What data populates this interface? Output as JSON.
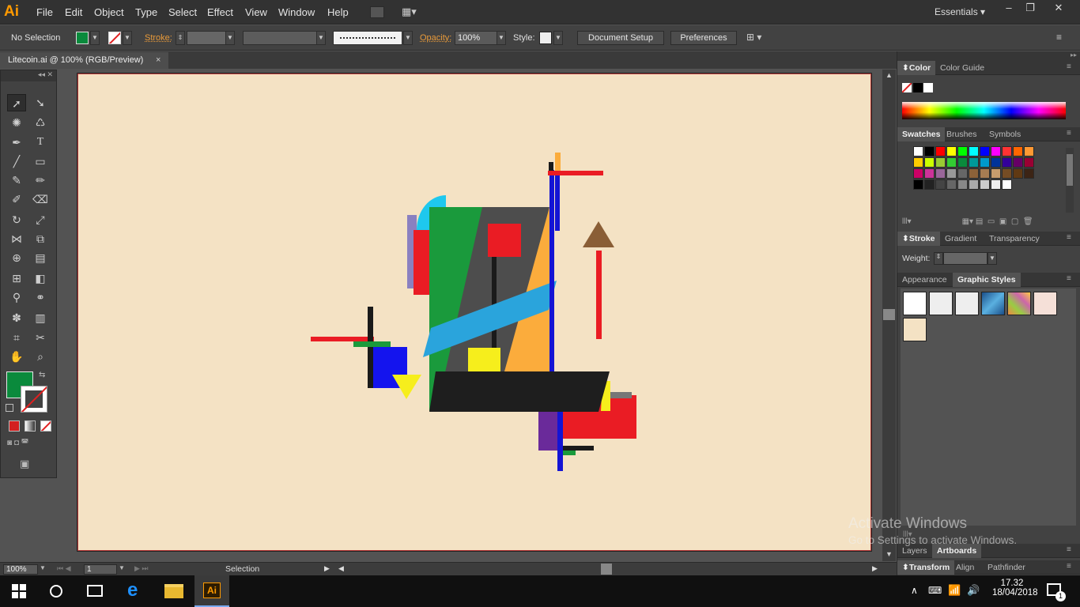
{
  "app": {
    "logo": "Ai"
  },
  "menu": [
    "File",
    "Edit",
    "Object",
    "Type",
    "Select",
    "Effect",
    "View",
    "Window",
    "Help"
  ],
  "workspace": "Essentials",
  "window_controls": {
    "minimize": "–",
    "restore": "❐",
    "close": "✕"
  },
  "control_bar": {
    "selection": "No Selection",
    "stroke_label": "Stroke:",
    "opacity_label": "Opacity:",
    "opacity_value": "100%",
    "style_label": "Style:",
    "document_setup": "Document Setup",
    "preferences": "Preferences"
  },
  "document_tab": {
    "title": "Litecoin.ai @ 100% (RGB/Preview)",
    "close": "×"
  },
  "status_bar": {
    "zoom": "100%",
    "page": "1",
    "tool": "Selection"
  },
  "panels": {
    "color_tabs": [
      "Color",
      "Color Guide"
    ],
    "swatch_tabs": [
      "Swatches",
      "Brushes",
      "Symbols"
    ],
    "stroke_tabs": [
      "Stroke",
      "Gradient",
      "Transparency"
    ],
    "weight_label": "Weight:",
    "appearance_tabs": [
      "Appearance",
      "Graphic Styles"
    ],
    "layer_tabs": [
      "Layers",
      "Artboards"
    ],
    "transform_tabs": [
      "Transform",
      "Align",
      "Pathfinder"
    ]
  },
  "watermark": {
    "line1": "Activate Windows",
    "line2": "Go to Settings to activate Windows."
  },
  "taskbar": {
    "time": "17.32",
    "date": "18/04/2018",
    "notification_count": "1"
  },
  "colors": {
    "fill": "#0a8a3c",
    "artboard": "#f4e2c4",
    "accent": "#ff9a00"
  },
  "swatch_grid": [
    [
      "#ffffff",
      "#000000",
      "#ff0000",
      "#ffff00",
      "#00ff00",
      "#00ffff",
      "#0000ff",
      "#ff00ff",
      "#ff3333",
      "#ff6600",
      "#ff9933"
    ],
    [
      "#ffcc00",
      "#ccff00",
      "#99cc33",
      "#33cc33",
      "#0a8a3c",
      "#009999",
      "#0099cc",
      "#003399",
      "#330099",
      "#660066",
      "#990033"
    ],
    [
      "#cc0066",
      "#cc3399",
      "#996699",
      "#999999",
      "#666666",
      "#8c6239",
      "#a67c52",
      "#c69c6d",
      "#754c24",
      "#603913",
      "#3c2415"
    ],
    [
      "#000000",
      "#222222",
      "#444444",
      "#666666",
      "#888888",
      "#aaaaaa",
      "#cccccc",
      "#eeeeee",
      "#ffffff"
    ]
  ]
}
